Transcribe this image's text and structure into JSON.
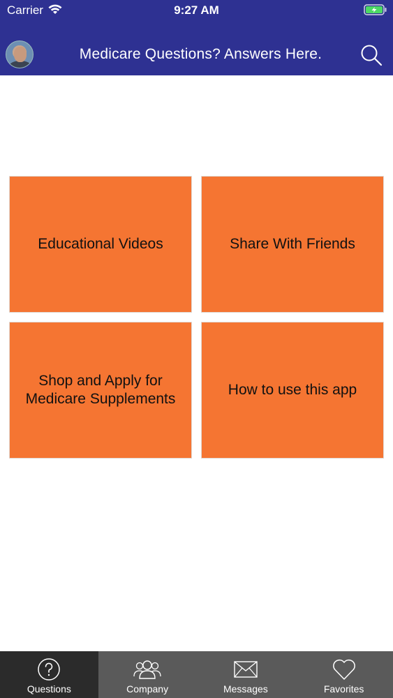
{
  "status_bar": {
    "carrier": "Carrier",
    "time": "9:27 AM"
  },
  "nav": {
    "title": "Medicare Questions? Answers Here."
  },
  "tiles": [
    {
      "label": "Educational Videos"
    },
    {
      "label": "Share With Friends"
    },
    {
      "label": "Shop and Apply for Medicare Supplements"
    },
    {
      "label": "How to use this app"
    }
  ],
  "tabs": [
    {
      "label": "Questions",
      "icon": "question-circle-icon"
    },
    {
      "label": "Company",
      "icon": "people-icon"
    },
    {
      "label": "Messages",
      "icon": "envelope-icon"
    },
    {
      "label": "Favorites",
      "icon": "heart-icon"
    }
  ],
  "colors": {
    "header": "#2e3192",
    "tile": "#f57532",
    "tab_bar": "#5a5a5a",
    "tab_active": "#2b2b2b",
    "battery_fill": "#4cd964"
  }
}
